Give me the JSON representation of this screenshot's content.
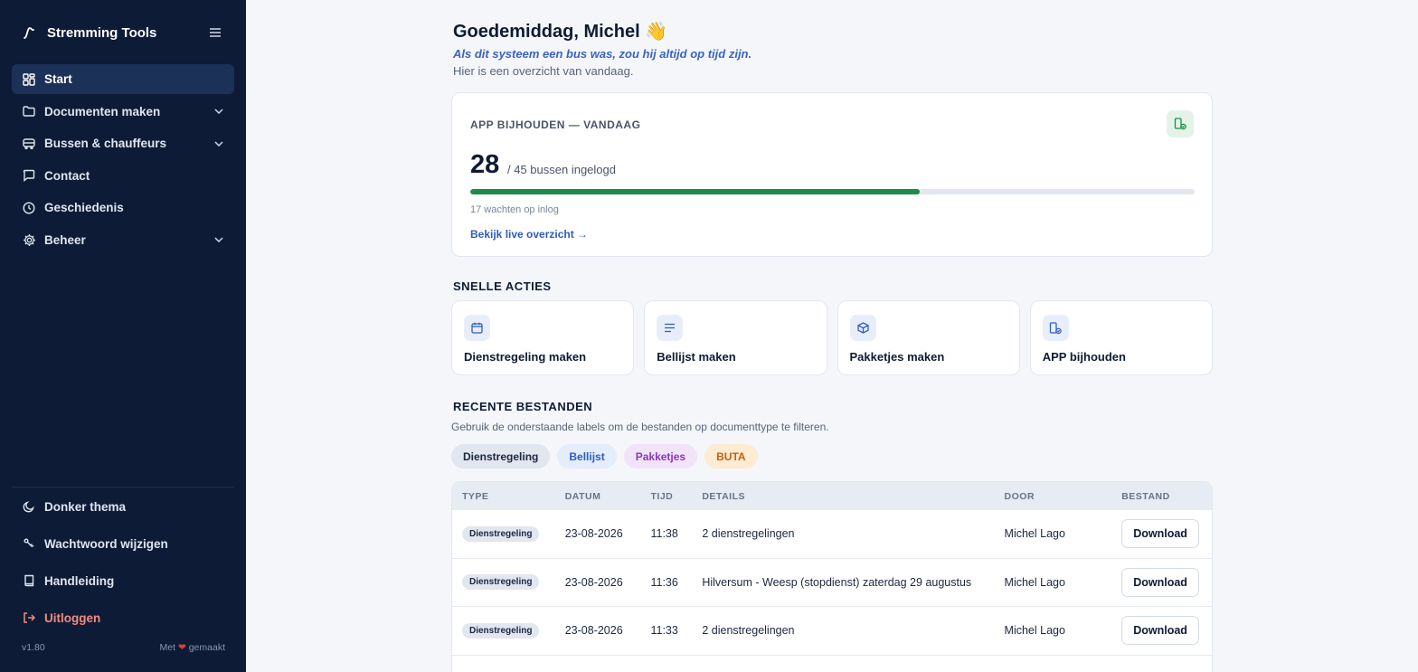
{
  "app": {
    "title": "Stremming Tools"
  },
  "sidebar": {
    "items": [
      {
        "label": "Start",
        "icon": "dashboard-icon",
        "active": true
      },
      {
        "label": "Documenten maken",
        "icon": "folder-icon",
        "expandable": true
      },
      {
        "label": "Bussen & chauffeurs",
        "icon": "bus-icon",
        "expandable": true
      },
      {
        "label": "Contact",
        "icon": "chat-icon"
      },
      {
        "label": "Geschiedenis",
        "icon": "clock-icon"
      },
      {
        "label": "Beheer",
        "icon": "gear-icon",
        "expandable": true
      }
    ],
    "bottom": {
      "theme": "Donker thema",
      "password": "Wachtwoord wijzigen",
      "manual": "Handleiding",
      "logout": "Uitloggen"
    },
    "version": "v1.80",
    "made_with_prefix": "Met",
    "made_with_suffix": "gemaakt"
  },
  "header": {
    "greeting": "Goedemiddag, Michel 👋",
    "tagline": "Als dit systeem een bus was, zou hij altijd op tijd zijn.",
    "subtitle": "Hier is een overzicht van vandaag."
  },
  "app_card": {
    "title": "APP BIJHOUDEN — VANDAAG",
    "logged_in": "28",
    "of_text": "/ 45 bussen ingelogd",
    "progress_fraction": 0.62,
    "waiting": "17 wachten op inlog",
    "link": "Bekijk live overzicht →",
    "accent": "#1e8a4c"
  },
  "quick_actions": {
    "title": "SNELLE ACTIES",
    "items": [
      {
        "label": "Dienstregeling maken",
        "icon": "calendar-icon"
      },
      {
        "label": "Bellijst maken",
        "icon": "list-icon"
      },
      {
        "label": "Pakketjes maken",
        "icon": "package-icon"
      },
      {
        "label": "APP bijhouden",
        "icon": "device-icon"
      }
    ]
  },
  "recent": {
    "title": "RECENTE BESTANDEN",
    "hint": "Gebruik de onderstaande labels om de bestanden op documenttype te filteren.",
    "filters": [
      "Dienstregeling",
      "Bellijst",
      "Pakketjes",
      "BUTA"
    ],
    "columns": [
      "TYPE",
      "DATUM",
      "TIJD",
      "DETAILS",
      "DOOR",
      "BESTAND"
    ],
    "rows": [
      {
        "type": "Dienstregeling",
        "date": "23-08-2026",
        "time": "11:38",
        "details": "2 dienstregelingen",
        "by": "Michel Lago",
        "file": "Download"
      },
      {
        "type": "Dienstregeling",
        "date": "23-08-2026",
        "time": "11:36",
        "details": "Hilversum - Weesp (stopdienst) zaterdag 29 augustus",
        "by": "Michel Lago",
        "file": "Download"
      },
      {
        "type": "Dienstregeling",
        "date": "23-08-2026",
        "time": "11:33",
        "details": "2 dienstregelingen",
        "by": "Michel Lago",
        "file": "Download"
      }
    ]
  }
}
